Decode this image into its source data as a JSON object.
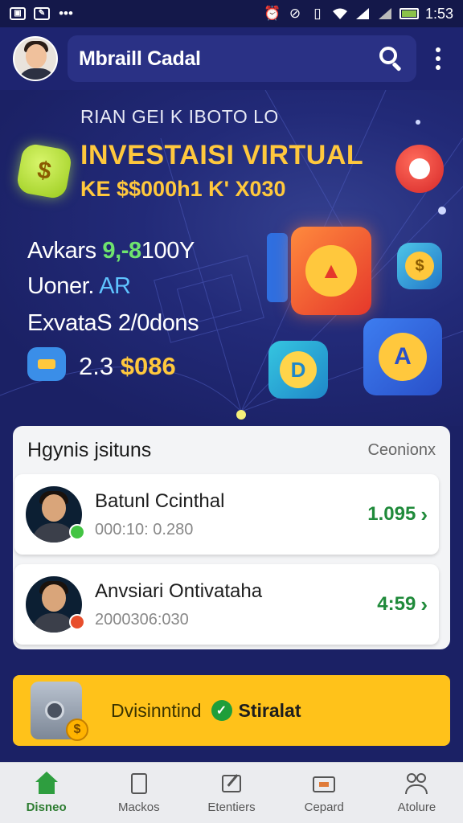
{
  "status_bar": {
    "time": "1:53",
    "left_icons": [
      "gallery-icon",
      "edit-icon",
      "more-dots-icon"
    ],
    "right_icons": [
      "alarm-icon",
      "dnd-icon",
      "vibrate-icon",
      "wifi-icon",
      "signal-icon",
      "signal-icon",
      "battery-icon"
    ]
  },
  "header": {
    "title": "Mbraill Cadal"
  },
  "hero": {
    "kicker": "RIAN GEI K IBOTO LO",
    "title": "INVESTAISI VIRTUAL",
    "subtitle": "KE $$000h1 K' X030",
    "stat1_label": "Avkars",
    "stat1_value": "9,-8",
    "stat1_suffix": "100Y",
    "stat2_label": "Uoner.",
    "stat2_value": "AR",
    "stat3_text": "ExvataS 2/0dons",
    "amount_prefix": "2.3",
    "amount_value": "$086"
  },
  "recent": {
    "title": "Hgynis jsituns",
    "link": "Ceonionx",
    "items": [
      {
        "name": "Batunl Ccinthal",
        "meta": "000:10: 0.280",
        "value": "1.095",
        "badge_color": "#43c443"
      },
      {
        "name": "Anvsiari Ontivataha",
        "meta": "2000306:030",
        "value": "4:59",
        "badge_color": "#e84e2c"
      }
    ]
  },
  "banner": {
    "text": "Dvisinntind",
    "cta": "Stiralat"
  },
  "nav": [
    {
      "label": "Disneo",
      "icon": "home-icon",
      "active": true
    },
    {
      "label": "Mackos",
      "icon": "document-icon",
      "active": false
    },
    {
      "label": "Etentiers",
      "icon": "edit-icon",
      "active": false
    },
    {
      "label": "Cepard",
      "icon": "card-icon",
      "active": false
    },
    {
      "label": "Atolure",
      "icon": "people-icon",
      "active": false
    }
  ],
  "colors": {
    "background": "#1b2165",
    "accent_yellow": "#ffc83d",
    "positive_green": "#1f8a3a",
    "nav_active": "#2e7d32"
  }
}
